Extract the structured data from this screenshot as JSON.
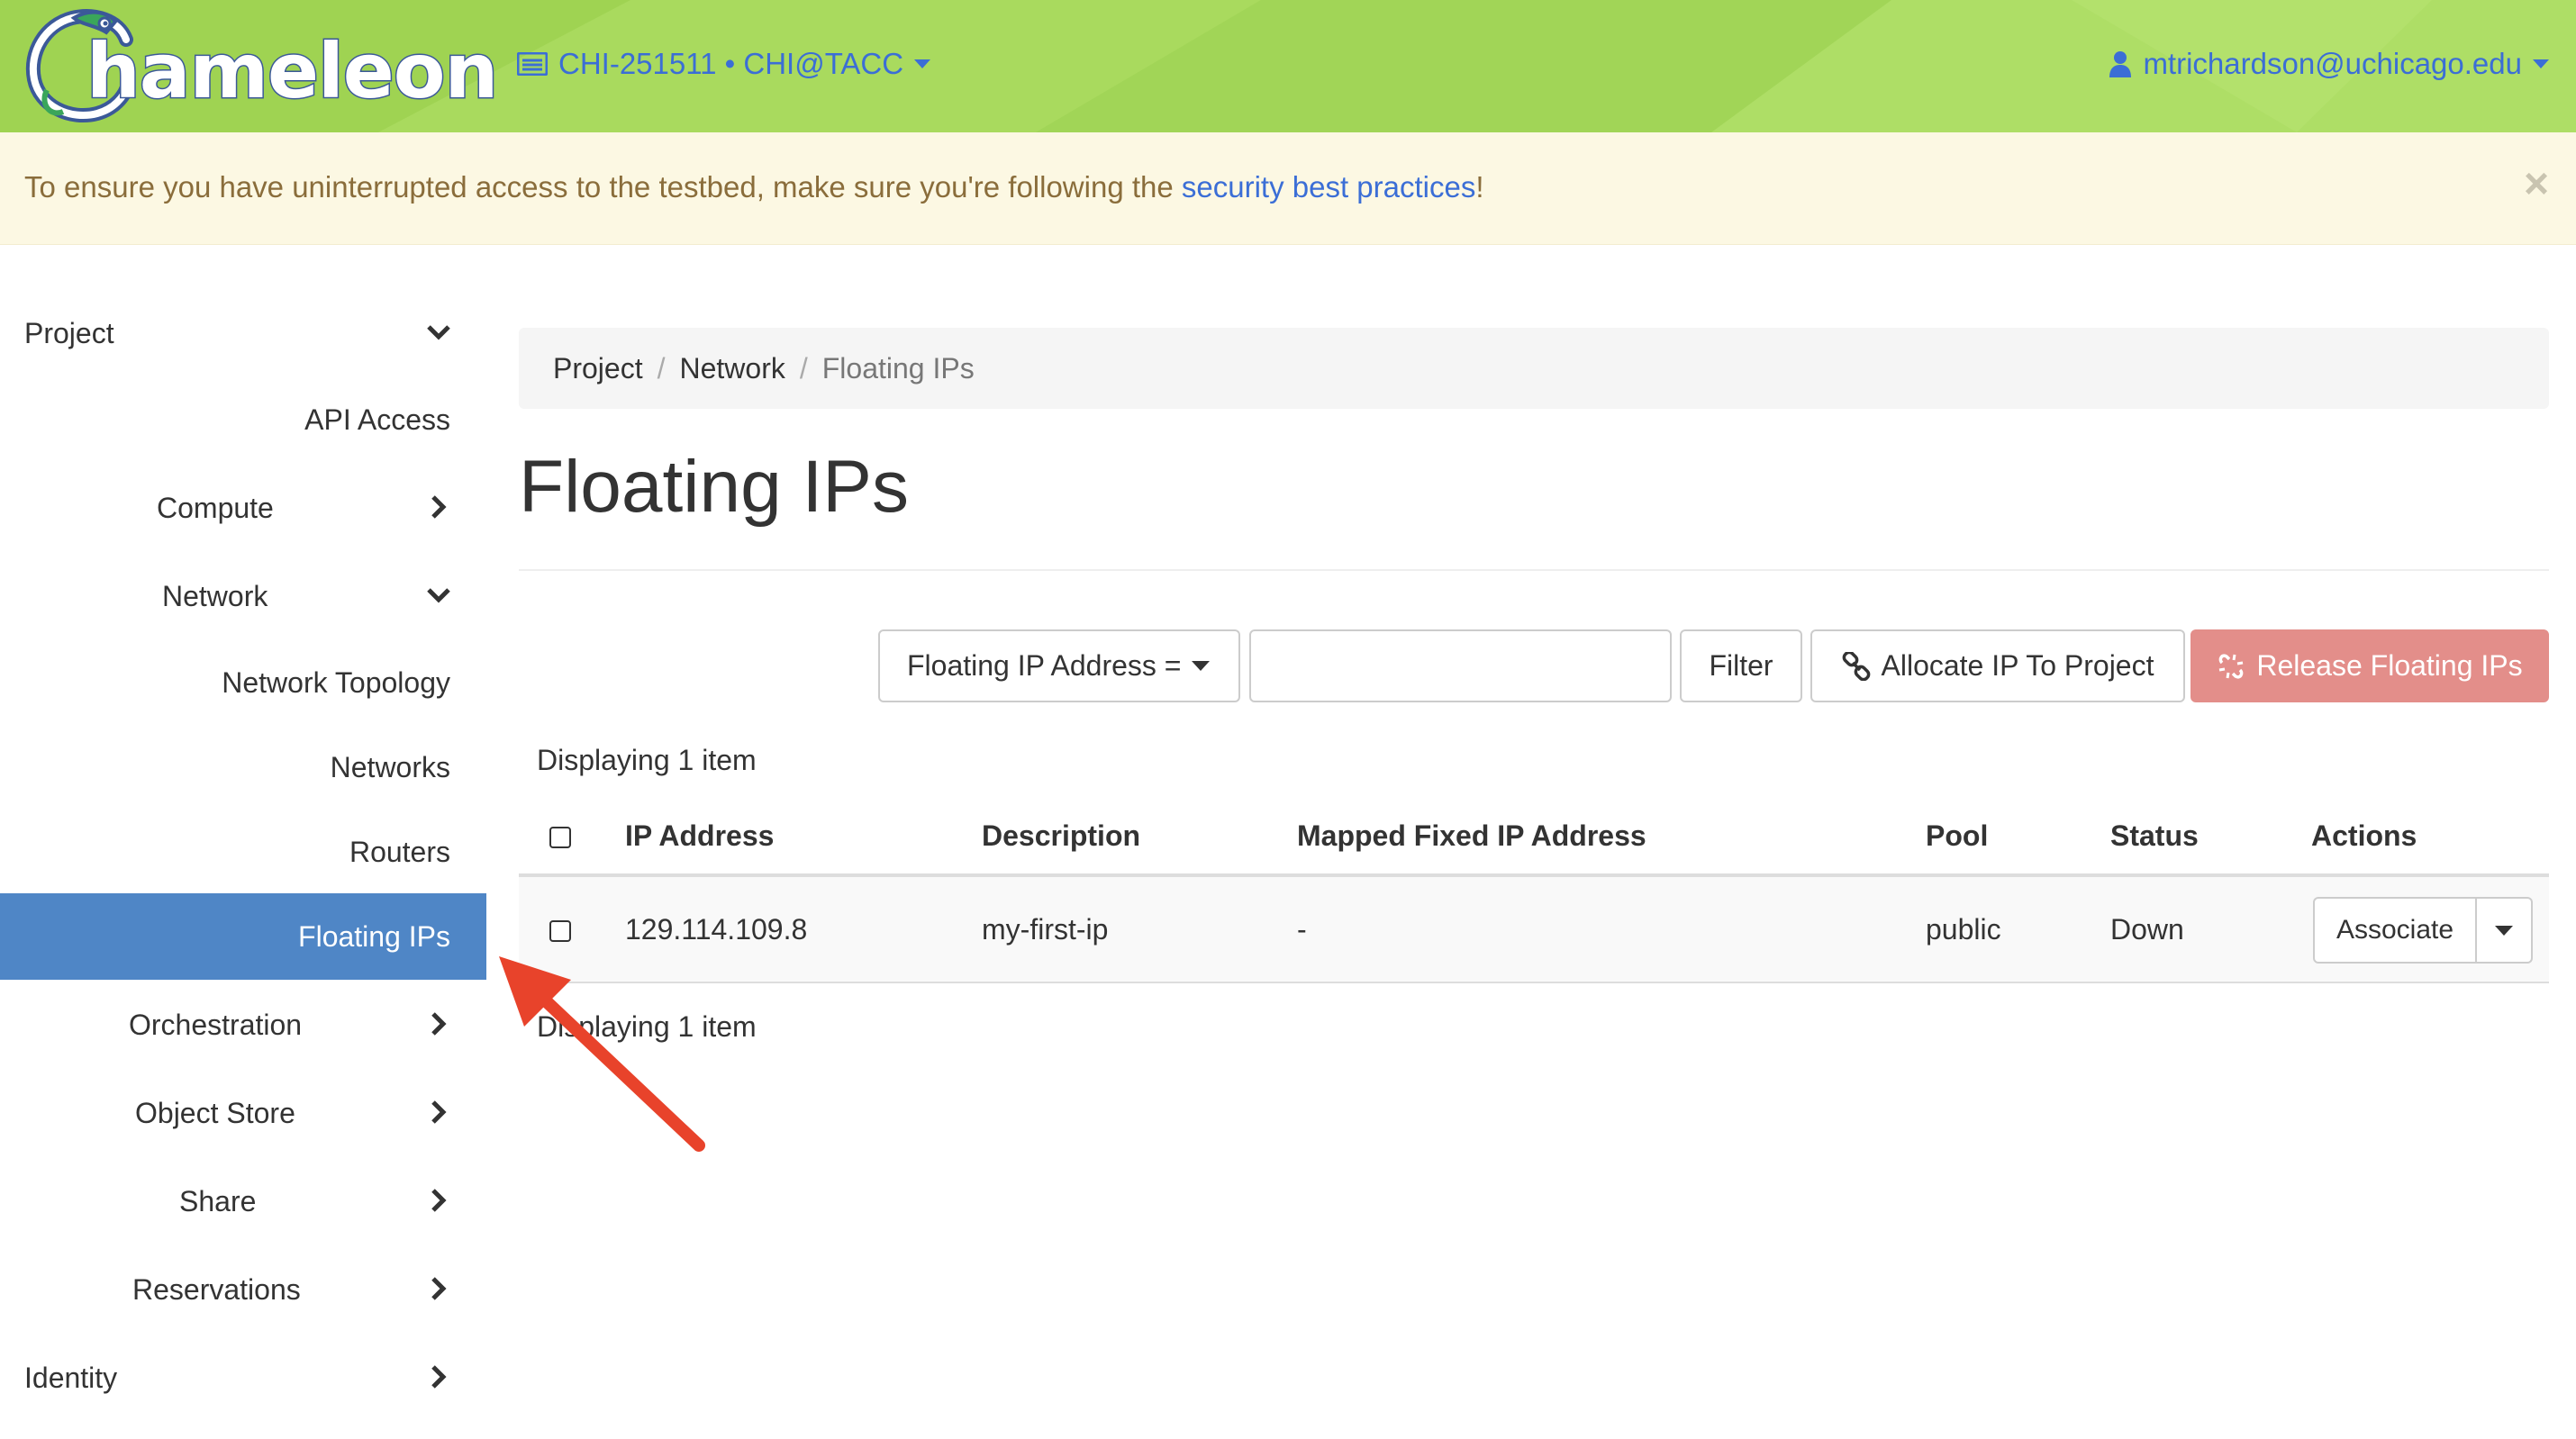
{
  "header": {
    "logo_text": "hameleon",
    "project": "CHI-251511 • CHI@TACC",
    "user": "mtrichardson@uchicago.edu"
  },
  "alert": {
    "text_before": "To ensure you have uninterrupted access to the testbed, make sure you're following the ",
    "link": "security best practices",
    "text_after": "!",
    "close": "×"
  },
  "sidebar": {
    "items": [
      {
        "label": "Project",
        "chevron": "down"
      },
      {
        "label": "API Access"
      },
      {
        "label": "Compute",
        "chevron": "right"
      },
      {
        "label": "Network",
        "chevron": "down"
      },
      {
        "label": "Network Topology"
      },
      {
        "label": "Networks"
      },
      {
        "label": "Routers"
      },
      {
        "label": "Floating IPs",
        "active": true
      },
      {
        "label": "Orchestration",
        "chevron": "right"
      },
      {
        "label": "Object Store",
        "chevron": "right"
      },
      {
        "label": "Share",
        "chevron": "right"
      },
      {
        "label": "Reservations",
        "chevron": "right"
      },
      {
        "label": "Identity",
        "chevron": "right"
      }
    ]
  },
  "breadcrumb": [
    "Project",
    "Network",
    "Floating IPs"
  ],
  "page_title": "Floating IPs",
  "toolbar": {
    "filter_field": "Floating IP Address =",
    "filter_value": "",
    "filter_button": "Filter",
    "allocate_button": "Allocate IP To Project",
    "release_button": "Release Floating IPs"
  },
  "table": {
    "count_text": "Displaying 1 item",
    "columns": [
      "IP Address",
      "Description",
      "Mapped Fixed IP Address",
      "Pool",
      "Status",
      "Actions"
    ],
    "rows": [
      {
        "ip": "129.114.109.8",
        "description": "my-first-ip",
        "mapped": "-",
        "pool": "public",
        "status": "Down",
        "action": "Associate"
      }
    ]
  },
  "colors": {
    "header_green": "#a3d65a",
    "link_blue": "#3b6ed6",
    "active_nav": "#4f86c6",
    "danger": "#e38e8a",
    "annotation_arrow": "#e8432b"
  }
}
